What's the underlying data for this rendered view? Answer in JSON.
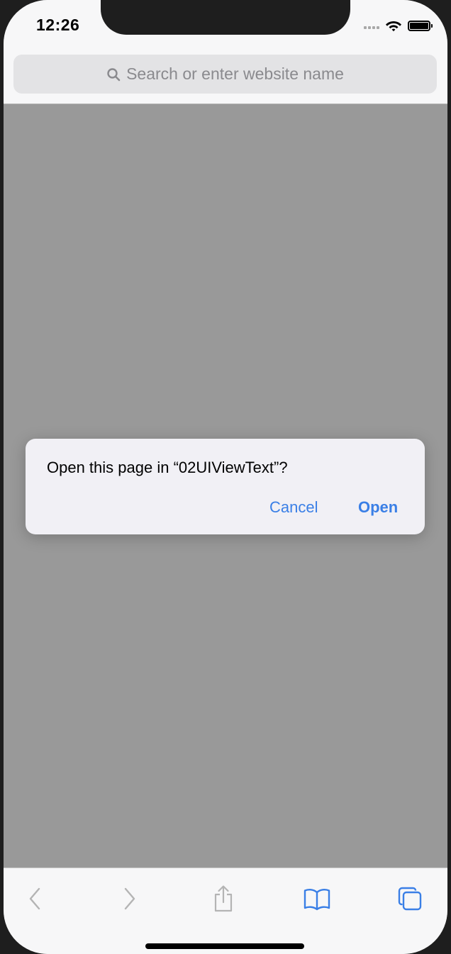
{
  "status_bar": {
    "time": "12:26",
    "icons": [
      "signal-icon",
      "wifi-icon",
      "battery-icon"
    ]
  },
  "search": {
    "placeholder": "Search or enter website name",
    "icon": "search-icon"
  },
  "dialog": {
    "message": "Open this page in “02UIViewText”?",
    "cancel_label": "Cancel",
    "open_label": "Open",
    "accent_color": "#3a7fe6"
  },
  "toolbar": {
    "items": [
      {
        "icon": "back-chevron-icon",
        "enabled": false
      },
      {
        "icon": "forward-chevron-icon",
        "enabled": false
      },
      {
        "icon": "share-icon",
        "enabled": false
      },
      {
        "icon": "bookmarks-icon",
        "enabled": true
      },
      {
        "icon": "tabs-icon",
        "enabled": true
      }
    ]
  },
  "colors": {
    "dimmed_background": "#999999",
    "chrome": "#f7f7f8",
    "disabled_icon": "#b4b4b4",
    "enabled_icon": "#3a7fe6"
  }
}
